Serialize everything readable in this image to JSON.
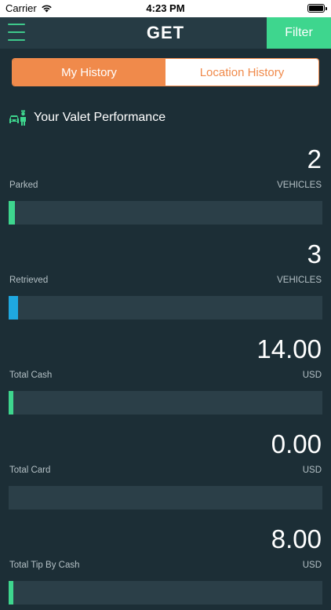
{
  "status_bar": {
    "carrier": "Carrier",
    "time": "4:23 PM"
  },
  "nav": {
    "logo_text": "GET",
    "filter_label": "Filter"
  },
  "tabs": [
    {
      "label": "My History",
      "active": true
    },
    {
      "label": "Location History",
      "active": false
    }
  ],
  "section": {
    "title": "Your Valet Performance",
    "icon": "valet-icon"
  },
  "metrics": [
    {
      "label": "Parked",
      "value": "2",
      "unit": "VEHICLES",
      "progress_percent": 2,
      "color": "#3ed68e"
    },
    {
      "label": "Retrieved",
      "value": "3",
      "unit": "VEHICLES",
      "progress_percent": 3,
      "color": "#1fa8e0"
    },
    {
      "label": "Total Cash",
      "value": "14.00",
      "unit": "USD",
      "progress_percent": 1.5,
      "color": "#3ed68e"
    },
    {
      "label": "Total Card",
      "value": "0.00",
      "unit": "USD",
      "progress_percent": 0,
      "color": "#3ed68e"
    },
    {
      "label": "Total Tip By Cash",
      "value": "8.00",
      "unit": "USD",
      "progress_percent": 1.5,
      "color": "#3ed68e"
    }
  ],
  "colors": {
    "background": "#1c2e36",
    "nav_background": "#263b44",
    "accent_green": "#3ed68e",
    "accent_orange": "#f08a4b",
    "track": "#2b3f48"
  }
}
